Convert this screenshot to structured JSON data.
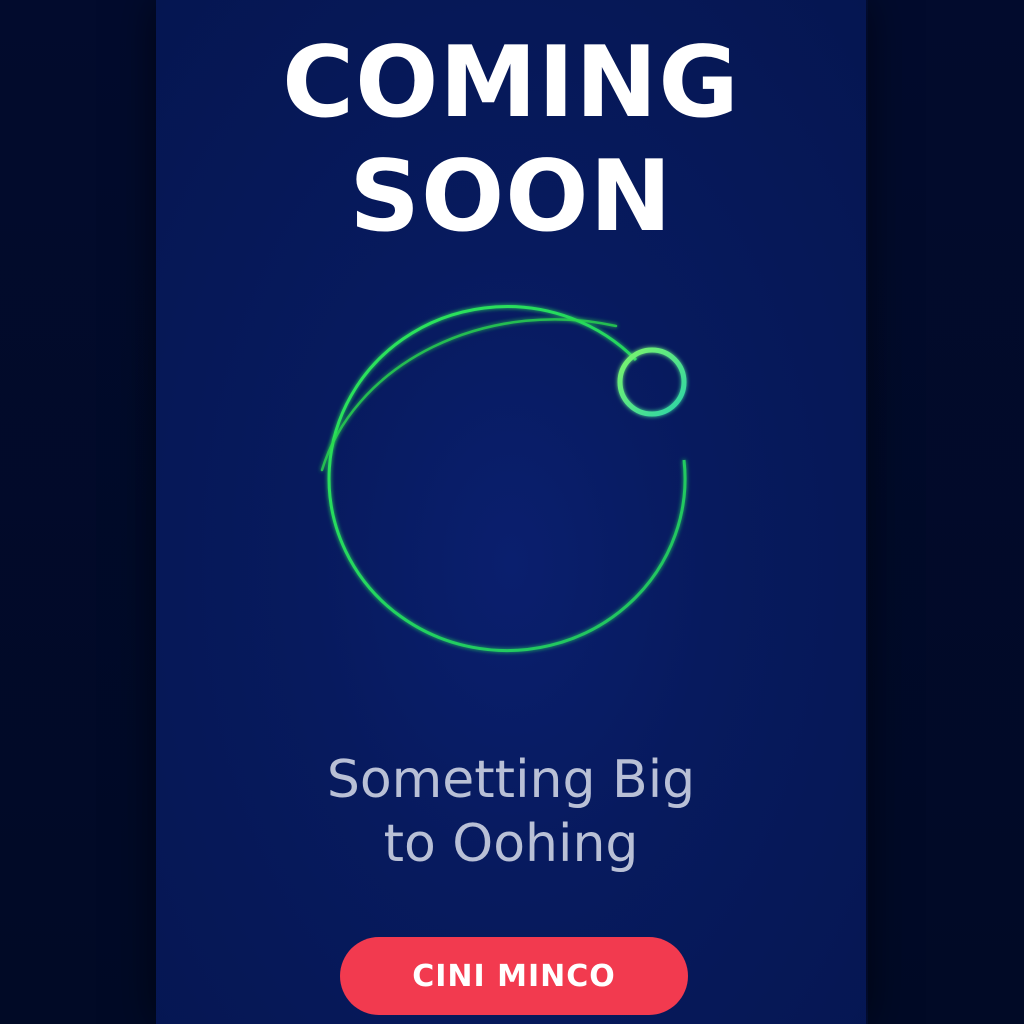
{
  "headline": {
    "line1": "COMING",
    "line2": "SOON"
  },
  "tagline": {
    "line1": "Sometting Big",
    "line2": "to Oohing"
  },
  "cta": {
    "label": "CINI MINCO"
  },
  "loader": {
    "icon": "orbit-ring-icon",
    "ring_color": "#22c55e",
    "dot_color": "#4ade80"
  },
  "colors": {
    "background": "#051651",
    "accent": "#f23a4f",
    "text": "#ffffff",
    "subtext": "#b9c0d6"
  }
}
